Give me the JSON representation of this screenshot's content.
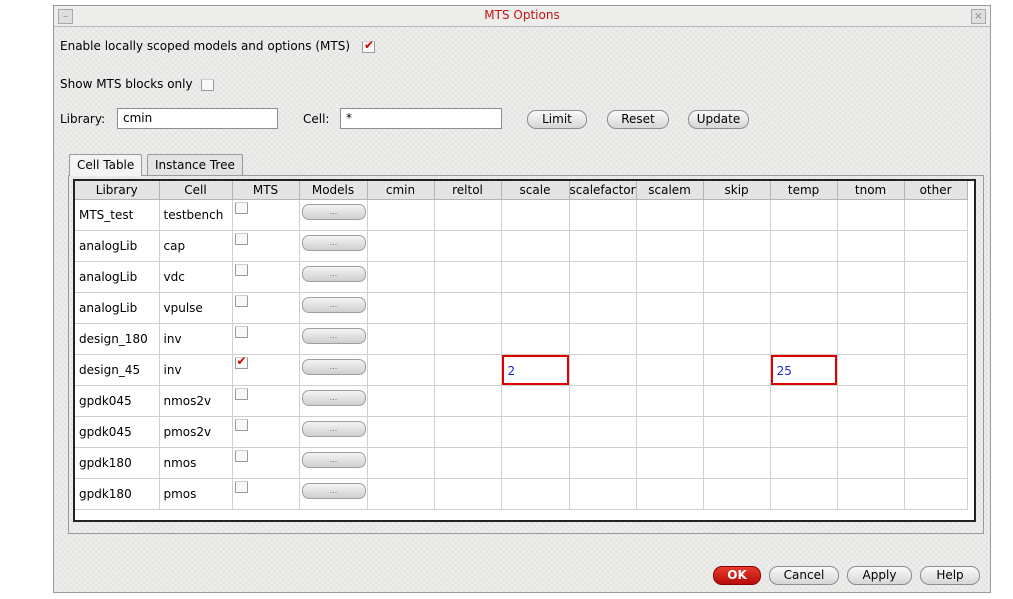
{
  "window": {
    "title": "MTS Options"
  },
  "options": {
    "enable_mts_label": "Enable locally scoped models and options (MTS)",
    "enable_mts_checked": true,
    "show_blocks_label": "Show MTS blocks only",
    "show_blocks_checked": false
  },
  "filters": {
    "library_label": "Library:",
    "library_value": "cmin",
    "cell_label": "Cell:",
    "cell_value": "*"
  },
  "buttons": {
    "limit": "Limit",
    "reset": "Reset",
    "update": "Update",
    "ok": "OK",
    "cancel": "Cancel",
    "apply": "Apply",
    "help": "Help"
  },
  "tabs": [
    "Cell Table",
    "Instance Tree"
  ],
  "table": {
    "columns": [
      "Library",
      "Cell",
      "MTS",
      "Models",
      "cmin",
      "reltol",
      "scale",
      "scalefactor",
      "scalem",
      "skip",
      "temp",
      "tnom",
      "other"
    ],
    "models_button_label": "...",
    "rows": [
      {
        "library": "MTS_test",
        "cell": "testbench",
        "mts": false,
        "scale": "",
        "temp": ""
      },
      {
        "library": "analogLib",
        "cell": "cap",
        "mts": false,
        "scale": "",
        "temp": ""
      },
      {
        "library": "analogLib",
        "cell": "vdc",
        "mts": false,
        "scale": "",
        "temp": ""
      },
      {
        "library": "analogLib",
        "cell": "vpulse",
        "mts": false,
        "scale": "",
        "temp": ""
      },
      {
        "library": "design_180",
        "cell": "inv",
        "mts": false,
        "scale": "",
        "temp": ""
      },
      {
        "library": "design_45",
        "cell": "inv",
        "mts": true,
        "scale": "2",
        "temp": "25"
      },
      {
        "library": "gpdk045",
        "cell": "nmos2v",
        "mts": false,
        "scale": "",
        "temp": ""
      },
      {
        "library": "gpdk045",
        "cell": "pmos2v",
        "mts": false,
        "scale": "",
        "temp": ""
      },
      {
        "library": "gpdk180",
        "cell": "nmos",
        "mts": false,
        "scale": "",
        "temp": ""
      },
      {
        "library": "gpdk180",
        "cell": "pmos",
        "mts": false,
        "scale": "",
        "temp": ""
      }
    ]
  },
  "colors": {
    "title": "#c41212",
    "check": "#d40000",
    "highlight_border": "#e00000",
    "value_text": "#1b2bd6",
    "ok_button": "#c81212"
  },
  "icons": {
    "minimize": "minimize-icon",
    "close": "close-icon",
    "check": "checkmark-icon"
  }
}
